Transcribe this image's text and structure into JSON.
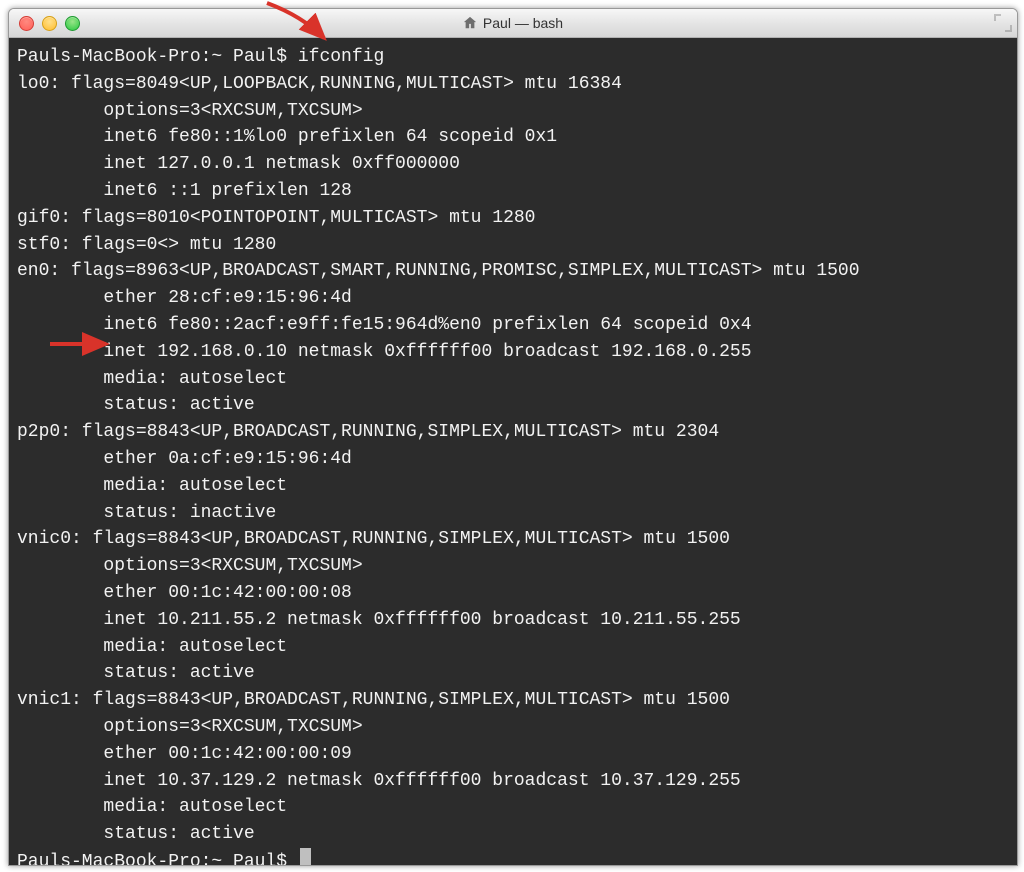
{
  "window": {
    "title": "Paul — bash"
  },
  "terminal": {
    "prompt": "Pauls-MacBook-Pro:~ Paul$ ",
    "command": "ifconfig",
    "lines": [
      "lo0: flags=8049<UP,LOOPBACK,RUNNING,MULTICAST> mtu 16384",
      "        options=3<RXCSUM,TXCSUM>",
      "        inet6 fe80::1%lo0 prefixlen 64 scopeid 0x1",
      "        inet 127.0.0.1 netmask 0xff000000",
      "        inet6 ::1 prefixlen 128",
      "gif0: flags=8010<POINTOPOINT,MULTICAST> mtu 1280",
      "stf0: flags=0<> mtu 1280",
      "en0: flags=8963<UP,BROADCAST,SMART,RUNNING,PROMISC,SIMPLEX,MULTICAST> mtu 1500",
      "        ether 28:cf:e9:15:96:4d",
      "        inet6 fe80::2acf:e9ff:fe15:964d%en0 prefixlen 64 scopeid 0x4",
      "        inet 192.168.0.10 netmask 0xffffff00 broadcast 192.168.0.255",
      "        media: autoselect",
      "        status: active",
      "p2p0: flags=8843<UP,BROADCAST,RUNNING,SIMPLEX,MULTICAST> mtu 2304",
      "        ether 0a:cf:e9:15:96:4d",
      "        media: autoselect",
      "        status: inactive",
      "vnic0: flags=8843<UP,BROADCAST,RUNNING,SIMPLEX,MULTICAST> mtu 1500",
      "        options=3<RXCSUM,TXCSUM>",
      "        ether 00:1c:42:00:00:08",
      "        inet 10.211.55.2 netmask 0xffffff00 broadcast 10.211.55.255",
      "        media: autoselect",
      "        status: active",
      "vnic1: flags=8843<UP,BROADCAST,RUNNING,SIMPLEX,MULTICAST> mtu 1500",
      "        options=3<RXCSUM,TXCSUM>",
      "        ether 00:1c:42:00:00:09",
      "        inet 10.37.129.2 netmask 0xffffff00 broadcast 10.37.129.255",
      "        media: autoselect",
      "        status: active"
    ],
    "prompt_end": "Pauls-MacBook-Pro:~ Paul$ "
  },
  "highlight_color": "#d9332a"
}
